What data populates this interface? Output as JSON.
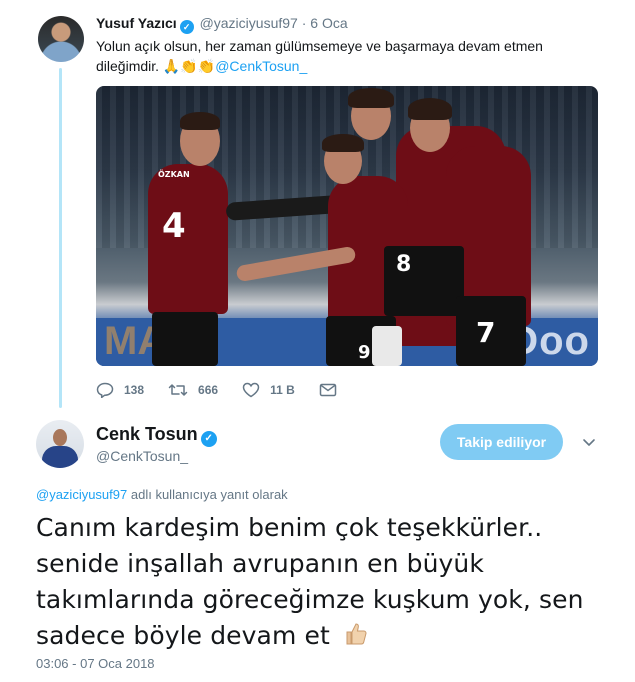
{
  "reply_tweet": {
    "author_name": "Yusuf Yazıcı",
    "author_handle": "@yaziciyusuf97",
    "separator": "·",
    "date": "6 Oca",
    "text_line1": "Yolun açık olsun, her zaman gülümsemeye ve başarmaya devam etmen",
    "text_line2_prefix": "dileğimdir.",
    "emojis": "🙏👏👏",
    "mention": "@CenkTosun_",
    "photo": {
      "board_text_right": "Doo",
      "board_text_left": "MA",
      "jersey_numbers": [
        "4",
        "8",
        "7",
        "9"
      ],
      "shirt_name": "ÖZKAN"
    },
    "actions": {
      "replies": "138",
      "retweets": "666",
      "likes": "11 B"
    }
  },
  "main_tweet": {
    "author_name": "Cenk Tosun",
    "author_handle": "@CenkTosun_",
    "follow_label": "Takip ediliyor",
    "reply_to_mention": "@yaziciyusuf97",
    "reply_to_suffix": "adlı kullanıcıya yanıt olarak",
    "text_line1": "Canım kardeşim benim çok teşekkürler..",
    "text_line2": "senide inşallah avrupanın en büyük",
    "text_line3": "takımlarında göreceğimze kuşkum yok, sen",
    "text_line4": "sadece böyle devam et",
    "timestamp": "03:06 - 07 Oca 2018"
  },
  "colors": {
    "accent": "#1da1f2",
    "thread_line": "#b4e5f8",
    "follow_button": "#80cbf3",
    "secondary_text": "#657786"
  },
  "icons": [
    "verified-badge-icon",
    "reply-icon",
    "retweet-icon",
    "like-icon",
    "direct-message-icon",
    "chevron-down-icon",
    "thumbs-up-emoji"
  ]
}
